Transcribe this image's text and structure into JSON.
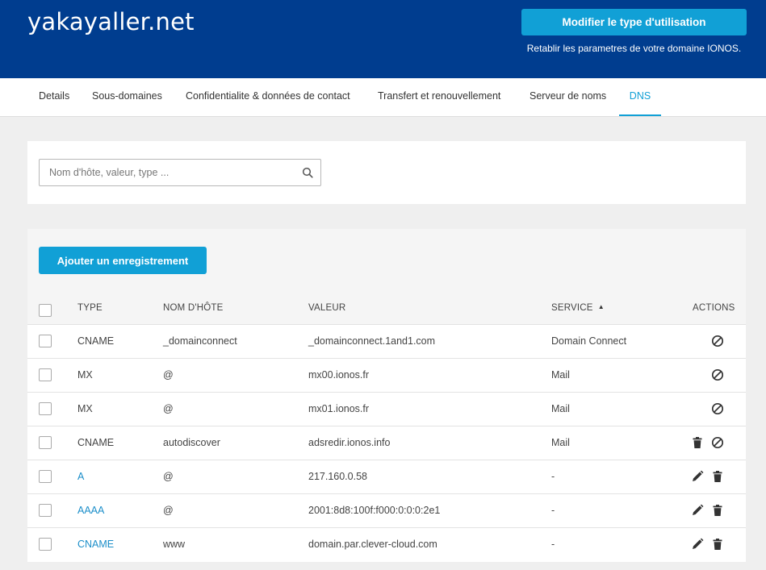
{
  "header": {
    "domain": "yakayaller.net",
    "modify_button": "Modifier le type d'utilisation",
    "reset_text": "Retablir les parametres de votre domaine IONOS."
  },
  "tabs": [
    {
      "label": "Details"
    },
    {
      "label": "Sous-domaines"
    },
    {
      "label": "Confidentialite & données de contact"
    },
    {
      "label": "Transfert et renouvellement"
    },
    {
      "label": "Serveur de noms"
    },
    {
      "label": "DNS",
      "active": true
    }
  ],
  "search": {
    "placeholder": "Nom d'hôte, valeur, type ..."
  },
  "records": {
    "add_button": "Ajouter un enregistrement",
    "columns": {
      "type": "TYPE",
      "host": "NOM D'HÔTE",
      "value": "VALEUR",
      "service": "SERVICE",
      "actions": "ACTIONS"
    },
    "sort": {
      "column": "service",
      "direction": "ascending"
    },
    "rows": [
      {
        "type": "CNAME",
        "host": "_domainconnect",
        "value": "_domainconnect.1and1.com",
        "service": "Domain Connect",
        "type_link": false,
        "actions": [
          "disable-icon"
        ]
      },
      {
        "type": "MX",
        "host": "@",
        "value": "mx00.ionos.fr",
        "service": "Mail",
        "type_link": false,
        "actions": [
          "disable-icon"
        ]
      },
      {
        "type": "MX",
        "host": "@",
        "value": "mx01.ionos.fr",
        "service": "Mail",
        "type_link": false,
        "actions": [
          "disable-icon"
        ]
      },
      {
        "type": "CNAME",
        "host": "autodiscover",
        "value": "adsredir.ionos.info",
        "service": "Mail",
        "type_link": false,
        "actions": [
          "trash-icon",
          "disable-icon"
        ]
      },
      {
        "type": "A",
        "host": "@",
        "value": "217.160.0.58",
        "service": "-",
        "type_link": true,
        "actions": [
          "edit-icon",
          "trash-icon"
        ]
      },
      {
        "type": "AAAA",
        "host": "@",
        "value": "2001:8d8:100f:f000:0:0:0:2e1",
        "service": "-",
        "type_link": true,
        "actions": [
          "edit-icon",
          "trash-icon"
        ]
      },
      {
        "type": "CNAME",
        "host": "www",
        "value": "domain.par.clever-cloud.com",
        "service": "-",
        "type_link": true,
        "actions": [
          "edit-icon",
          "trash-icon"
        ]
      }
    ]
  },
  "colors": {
    "header_bg": "#003d8f",
    "accent": "#11a0d6",
    "link": "#1b8ec9",
    "page_bg": "#efefef"
  }
}
